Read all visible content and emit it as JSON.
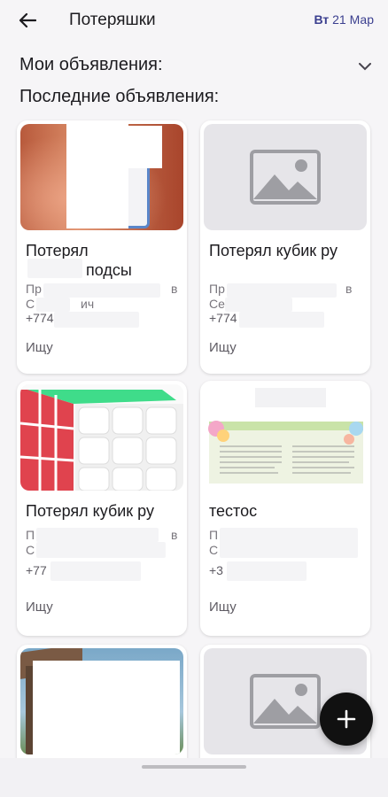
{
  "header": {
    "title": "Потеряшки",
    "day": "Вт",
    "date": "21 Мар"
  },
  "sections": {
    "my_ads": "Мои объявления:",
    "latest_ads": "Последние объявления:"
  },
  "cards": [
    {
      "title": "Потерял",
      "title2": "подсы",
      "desc1": "Пр",
      "desc1b": "в",
      "desc2": "С",
      "desc2b": "ич",
      "phone": "+774",
      "status": "Ищу"
    },
    {
      "title": "Потерял кубик ру",
      "desc1": "Пр",
      "desc1b": "в",
      "desc2": "Се",
      "phone": "+774",
      "status": "Ищу"
    },
    {
      "title": "Потерял кубик ру",
      "desc1": "П",
      "desc1b": "в",
      "desc2": "С",
      "phone": "+77",
      "status": "Ищу"
    },
    {
      "title": "тестос",
      "desc1": "П",
      "desc2": "С",
      "phone": "+3",
      "status": "Ищу"
    }
  ],
  "colors": {
    "accent": "#3b3f8f",
    "fab": "#111111",
    "background": "#f6f5f7"
  }
}
